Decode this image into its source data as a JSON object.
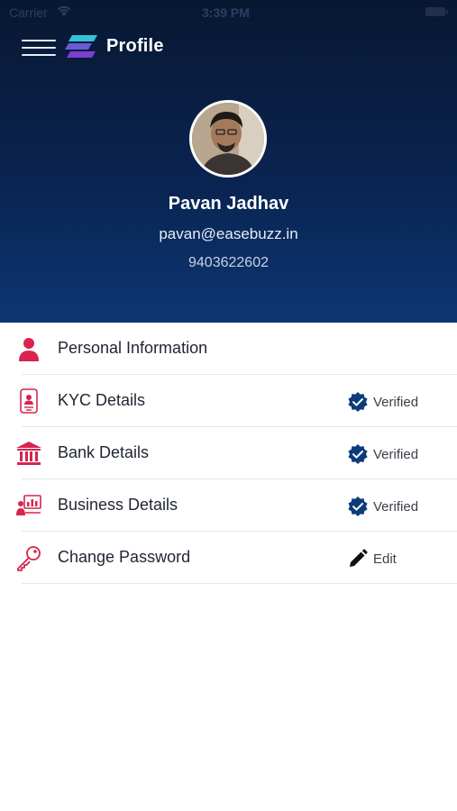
{
  "status_bar": {
    "carrier": "Carrier",
    "time": "3:39 PM"
  },
  "header": {
    "title": "Profile"
  },
  "profile": {
    "name": "Pavan Jadhav",
    "email": "pavan@easebuzz.in",
    "phone": "9403622602"
  },
  "menu": [
    {
      "label": "Personal Information",
      "status": ""
    },
    {
      "label": "KYC Details",
      "status": "Verified"
    },
    {
      "label": "Bank Details",
      "status": "Verified"
    },
    {
      "label": "Business Details",
      "status": "Verified"
    },
    {
      "label": "Change Password",
      "status": "Edit"
    }
  ],
  "colors": {
    "accent": "#d6254f",
    "verified": "#0d3b7a",
    "header_top": "#081832",
    "header_bottom": "#0c3672"
  },
  "icons": [
    "menu-icon",
    "easebuzz-logo",
    "person-icon",
    "id-card-icon",
    "bank-icon",
    "business-icon",
    "key-icon",
    "verified-badge-icon",
    "pencil-icon"
  ]
}
